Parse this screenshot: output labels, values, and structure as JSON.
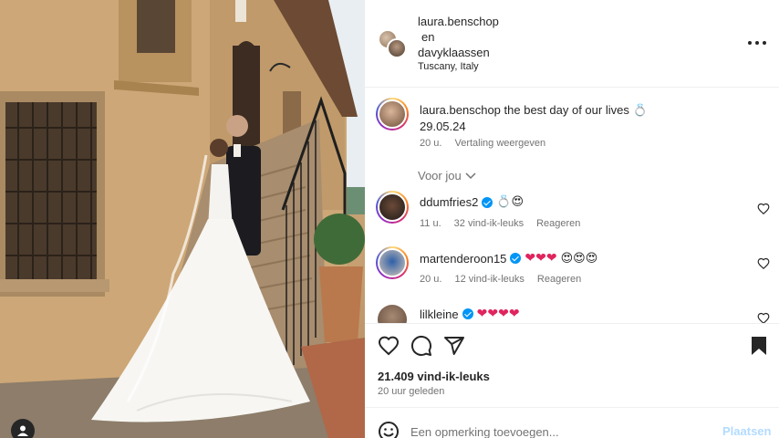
{
  "header": {
    "user1": "laura.benschop",
    "conjunction": "en",
    "user2": "davyklaassen",
    "location": "Tuscany, Italy"
  },
  "caption": {
    "username": "laura.benschop",
    "text": "the best day of our lives 💍",
    "date": "29.05.24",
    "time": "20 u.",
    "translate": "Vertaling weergeven"
  },
  "for_you": "Voor jou",
  "comments": [
    {
      "username": "ddumfries2",
      "text": "💍😍",
      "time": "11 u.",
      "likes": "32 vind-ik-leuks",
      "reply": "Reageren"
    },
    {
      "username": "martenderoon15",
      "hearts": "❤❤❤",
      "faces": "😍😍😍",
      "time": "20 u.",
      "likes": "12 vind-ik-leuks",
      "reply": "Reageren"
    },
    {
      "username": "lilkleine",
      "text": "❤❤❤❤"
    }
  ],
  "stats": {
    "likes": "21.409 vind-ik-leuks",
    "posted": "20 uur geleden"
  },
  "comment_input": {
    "placeholder": "Een opmerking toevoegen...",
    "post_label": "Plaatsen"
  },
  "colors": {
    "accent_blue": "#0095f6",
    "post_disabled": "#b3dbff",
    "muted_text": "#737373",
    "heart_red": "#e0245e"
  }
}
